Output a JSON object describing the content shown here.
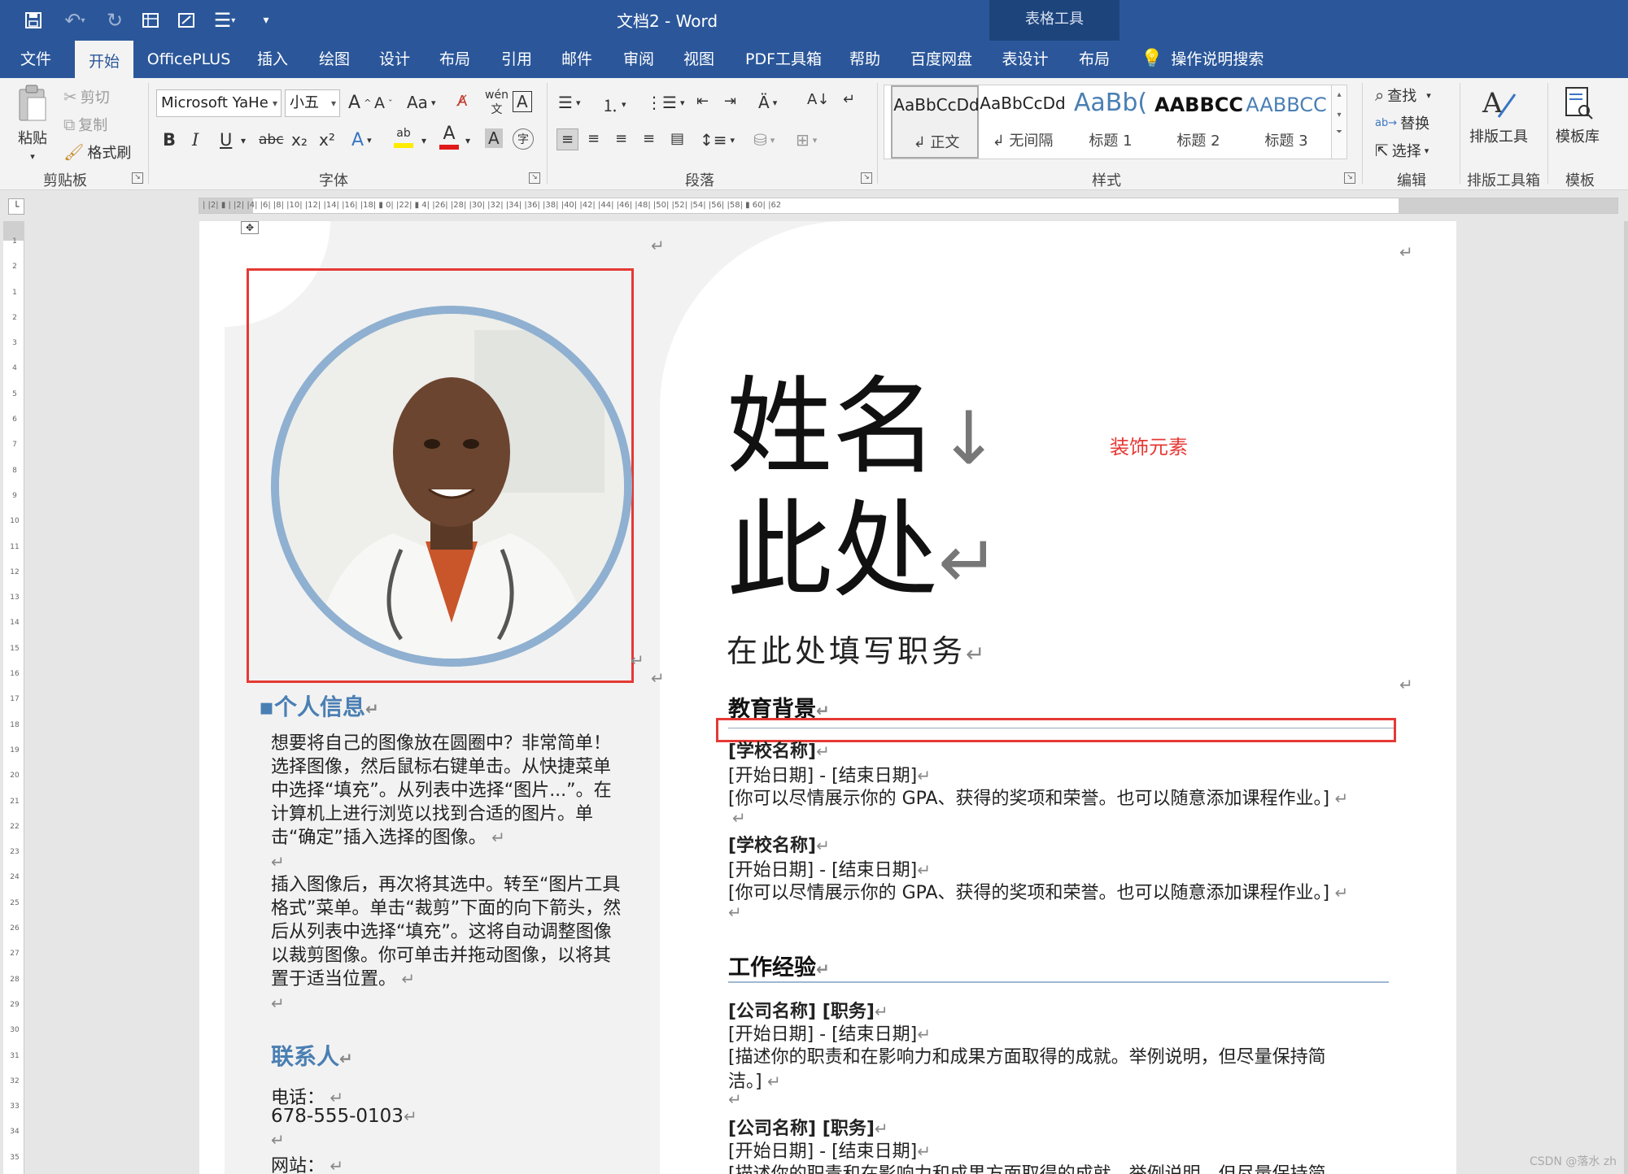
{
  "window": {
    "title": "文档2  -  Word",
    "contextual_tab_group": "表格工具"
  },
  "quick_access": {
    "save_icon": "save-icon",
    "undo_icon": "undo-icon",
    "redo_icon": "redo-icon"
  },
  "tabs": [
    "文件",
    "开始",
    "OfficePLUS",
    "插入",
    "绘图",
    "设计",
    "布局",
    "引用",
    "邮件",
    "审阅",
    "视图",
    "PDF工具箱",
    "帮助",
    "百度网盘",
    "表设计",
    "布局"
  ],
  "active_tab": "开始",
  "tell_me": "操作说明搜索",
  "clipboard": {
    "paste": "粘贴",
    "cut": "剪切",
    "copy": "复制",
    "format_painter": "格式刷",
    "label": "剪贴板"
  },
  "font": {
    "name": "Microsoft YaHe",
    "size": "小五",
    "change_case": "Aa",
    "label": "字体",
    "bold": "B",
    "italic": "I",
    "underline": "U",
    "strike": "abc",
    "sub": "x₂",
    "sup": "x²"
  },
  "paragraph": {
    "label": "段落"
  },
  "styles": {
    "label": "样式",
    "items": [
      {
        "sample": "AaBbCcDd",
        "name": "↲ 正文"
      },
      {
        "sample": "AaBbCcDd",
        "name": "↲ 无间隔"
      },
      {
        "sample": "AaBb(",
        "name": "标题 1"
      },
      {
        "sample": "AABBCC",
        "name": "标题 2"
      },
      {
        "sample": "AABBCC",
        "name": "标题 3"
      }
    ]
  },
  "editing": {
    "find": "查找",
    "replace": "替换",
    "select": "选择",
    "label": "编辑"
  },
  "layout_tools": {
    "button": "排版工具",
    "label": "排版工具箱"
  },
  "templates": {
    "button": "模板库",
    "label": "模板"
  },
  "ruler": {
    "h_numbers": "|  |2|  ▮  |  |2|  |4|  |6|  |8|  |10|  |12|  |14|  |16|  |18|  ▮  0|  |22|  ▮  4|  |26|  |28|  |30|  |32|  |34|  |36|  |38|  |40|  |42|  |44|  |46|  |48|  |50|  |52|  |54|  |56|  |58|  ▮ 60|  |62"
  },
  "resume": {
    "name_line1": "姓名",
    "name_line2": "此处",
    "job": "在此处填写职务",
    "deco_annotation": "装饰元素",
    "personal_title": "个人信息",
    "personal_p1": "想要将自己的图像放在圆圈中？非常简单！选择图像，然后鼠标右键单击。从快捷菜单中选择“填充”。从列表中选择“图片...”。在计算机上进行浏览以找到合适的图片。单击“确定”插入选择的图像。",
    "personal_p2": "插入图像后，再次将其选中。转至“图片工具格式”菜单。单击“裁剪”下面的向下箭头，然后从列表中选择“填充”。这将自动调整图像以裁剪图像。你可单击并拖动图像，以将其置于适当位置。",
    "contact_title": "联系人",
    "phone_label": "电话：",
    "phone": "678-555-0103",
    "website_label": "网站：",
    "edu_title": "教育背景",
    "edu": [
      {
        "school": "[学校名称]",
        "dates": "[开始日期] - [结束日期]",
        "desc": "[你可以尽情展示你的 GPA、获得的奖项和荣誉。也可以随意添加课程作业。]"
      },
      {
        "school": "[学校名称]",
        "dates": "[开始日期] - [结束日期]",
        "desc": "[你可以尽情展示你的 GPA、获得的奖项和荣誉。也可以随意添加课程作业。]"
      }
    ],
    "work_title": "工作经验",
    "work": [
      {
        "company": "[公司名称] [职务]",
        "dates": "[开始日期] - [结束日期]",
        "desc1": "[描述你的职责和在影响力和成果方面取得的成就。举例说明，但尽量保持简",
        "desc2": "洁。]"
      },
      {
        "company": "[公司名称] [职务]",
        "dates": "[开始日期] - [结束日期]",
        "desc1": "[描述你的职责和在影响力和成果方面取得的成就。举例说明，但尽量保持简"
      }
    ]
  },
  "watermark": "CSDN @落水 zh"
}
